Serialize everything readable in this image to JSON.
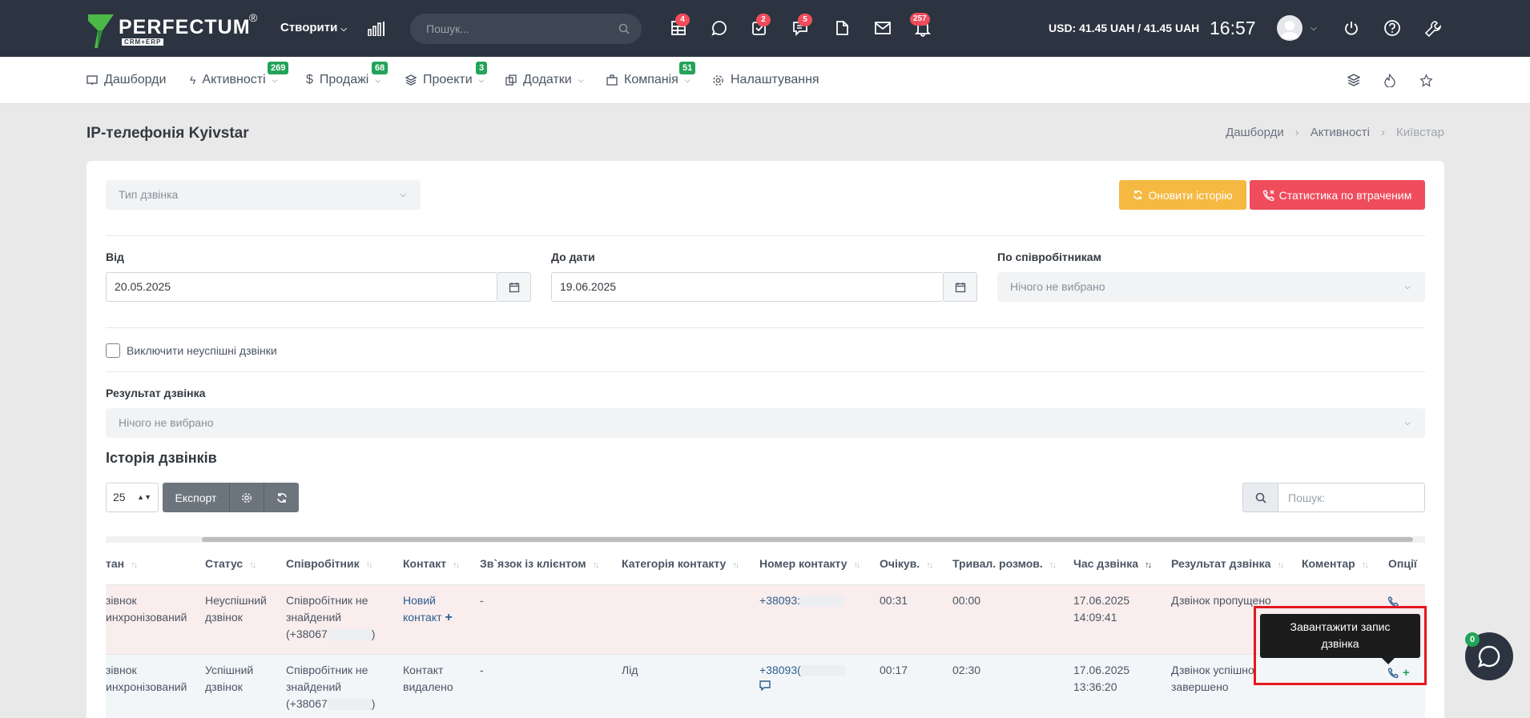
{
  "topbar": {
    "logo_text": "PERFECTUM",
    "logo_reg": "®",
    "logo_sub": "CRM+ERP",
    "create_label": "Створити",
    "search_placeholder": "Пошук...",
    "badges": {
      "tables": "4",
      "tasks": "2",
      "messages": "5",
      "notifications": "257"
    },
    "currency": "USD: 41.45 UAH / 41.45 UAH",
    "clock": "16:57"
  },
  "nav": {
    "items": [
      {
        "label": "Дашборди"
      },
      {
        "label": "Активності",
        "badge": "269"
      },
      {
        "label": "Продажі",
        "badge": "68"
      },
      {
        "label": "Проекти",
        "badge": "3"
      },
      {
        "label": "Додатки"
      },
      {
        "label": "Компанія",
        "badge": "51"
      },
      {
        "label": "Налаштування"
      }
    ]
  },
  "page": {
    "title": "IP-телефонія Kyivstar",
    "breadcrumb": [
      "Дашборди",
      "Активності",
      "Київстар"
    ]
  },
  "filters": {
    "call_type_placeholder": "Тип дзвінка",
    "refresh_label": "Оновити історію",
    "stats_label": "Статистика по втраченим",
    "from_label": "Від",
    "from_value": "20.05.2025",
    "to_label": "До дати",
    "to_value": "19.06.2025",
    "employees_label": "По співробітникам",
    "employees_placeholder": "Нічого не вибрано",
    "exclude_label": "Виключити неуспішні дзвінки",
    "result_label": "Результат дзвінка",
    "result_placeholder": "Нічого не вибрано"
  },
  "history": {
    "title": "Історія дзвінків",
    "page_size": "25",
    "export_label": "Експорт",
    "search_placeholder": "Пошук:"
  },
  "table": {
    "columns": [
      "тан",
      "Статус",
      "Співробітник",
      "Контакт",
      "Зв`язок із клієнтом",
      "Категорія контакту",
      "Номер контакту",
      "Очікув.",
      "Тривал. розмов.",
      "Час дзвінка",
      "Результат дзвінка",
      "Коментар",
      "Опції"
    ],
    "rows": [
      {
        "state_l1": "зівнок",
        "state_l2": "инхронізований",
        "status_l1": "Неуспішний",
        "status_l2": "дзвінок",
        "employee_l1": "Співробітник не",
        "employee_l2": "знайдений",
        "employee_l3": "(+38067",
        "contact_l1": "Новий",
        "contact_l2": "контакт",
        "relation": "-",
        "category": "",
        "phone": "+38093:",
        "wait": "00:31",
        "duration": "00:00",
        "date": "17.06.2025",
        "time": "14:09:41",
        "result_l1": "Дзвінок пропущено",
        "result_l2": ""
      },
      {
        "state_l1": "зівнок",
        "state_l2": "инхронізований",
        "status_l1": "Успішний",
        "status_l2": "дзвінок",
        "employee_l1": "Співробітник не",
        "employee_l2": "знайдений",
        "employee_l3": "(+38067",
        "contact_l1": "Контакт",
        "contact_l2": "видалено",
        "relation": "-",
        "category": "Лід",
        "phone": "+38093(",
        "wait": "00:17",
        "duration": "02:30",
        "date": "17.06.2025",
        "time": "13:36:20",
        "result_l1": "Дзвінок успішно",
        "result_l2": "завершено"
      }
    ]
  },
  "tooltip": {
    "line1": "Завантажити запис",
    "line2": "дзвінка"
  },
  "chat": {
    "badge": "0"
  },
  "colors": {
    "topbar": "#2b3440",
    "accent_green": "#22a35a",
    "badge_red": "#ef4c5c",
    "refresh_btn": "#f5b942",
    "stats_btn": "#ef4c5c",
    "failed_row": "#f9eded",
    "success_row": "#f3f6f8",
    "highlight": "#e5171f"
  }
}
